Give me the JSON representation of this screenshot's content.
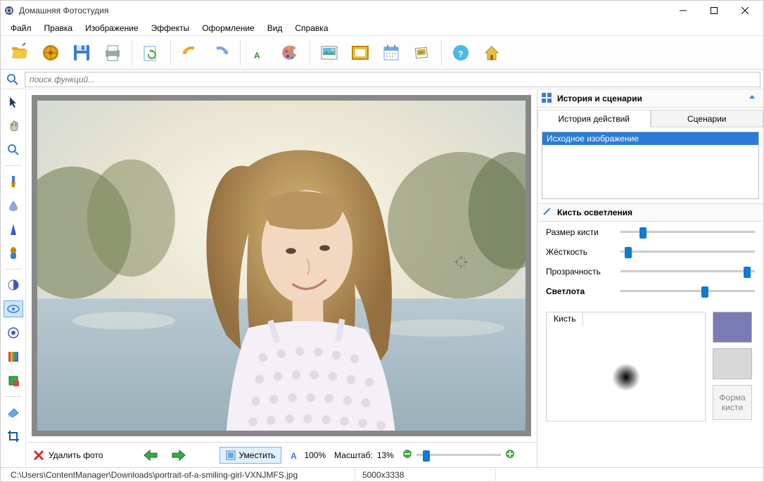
{
  "window": {
    "title": "Домашняя Фотостудия"
  },
  "menu": [
    "Файл",
    "Правка",
    "Изображение",
    "Эффекты",
    "Оформление",
    "Вид",
    "Справка"
  ],
  "search": {
    "placeholder": "поиск функций..."
  },
  "history": {
    "panel_title": "История и сценарии",
    "tabs": [
      "История действий",
      "Сценарии"
    ],
    "items": [
      "Исходное изображение"
    ]
  },
  "brush": {
    "panel_title": "Кисть осветления",
    "sliders": {
      "size": {
        "label": "Размер кисти",
        "pos": 14
      },
      "hard": {
        "label": "Жёсткость",
        "pos": 3
      },
      "opacity": {
        "label": "Прозрачность",
        "pos": 97
      },
      "lightness": {
        "label": "Светлота",
        "pos": 60
      }
    },
    "preview_tab": "Кисть",
    "swatch_color": "#7a7ab5",
    "shape_btn": "Форма кисти"
  },
  "bottom": {
    "delete": "Удалить фото",
    "fit": "Уместить",
    "zoom100": "100%",
    "zoom_label": "Масштаб:",
    "zoom_value": "13%"
  },
  "status": {
    "path": "C:\\Users\\ContentManager\\Downloads\\portrait-of-a-smiling-girl-VXNJMFS.jpg",
    "dims": "5000x3338"
  }
}
